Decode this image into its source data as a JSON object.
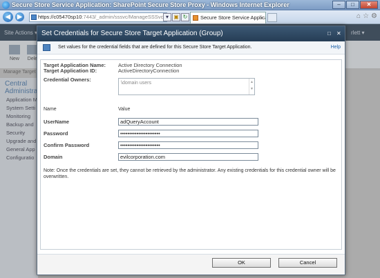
{
  "window": {
    "title": "Secure Store Service Application: SharePoint Secure Store Proxy - Windows Internet Explorer",
    "minimize": "–",
    "maximize": "□",
    "close": "✕"
  },
  "browser": {
    "url_main": "https://c05470sp10",
    "url_rest": ":7443/_admin/sssvc/ManageSSSvcAppl",
    "tab_title": "Secure Store Service Applica...",
    "tab_close": "x",
    "back": "◀",
    "forward": "▶"
  },
  "sharepoint": {
    "site_actions": "Site Actions ▾",
    "user": "rlett ▾",
    "ribbon_new": "New",
    "ribbon_delete": "Dele",
    "manage_target": "Manage Target",
    "leftnav_head": "Central Administra",
    "leftnav_items": [
      "Application M",
      "System Setti",
      "Monitoring",
      "Backup and",
      "Security",
      "Upgrade and",
      "General App Settings",
      "Configuratio"
    ]
  },
  "dialog": {
    "title": "Set Credentials for Secure Store Target Application (Group)",
    "info_text": "Set values for the credential fields that are defined for this Secure Store Target Application.",
    "help": "Help",
    "target_name_label": "Target Application Name:",
    "target_name_value": "Active Directory Connection",
    "target_id_label": "Target Application ID:",
    "target_id_value": "ActiveDirectoryConnection",
    "owners_label": "Credential Owners:",
    "owners_value": "\\domain users",
    "col_name": "Name",
    "col_value": "Value",
    "fields": [
      {
        "label": "UserName",
        "value": "adQueryAccount"
      },
      {
        "label": "Password",
        "value": "••••••••••••••••••••••"
      },
      {
        "label": "Confirm Password",
        "value": "••••••••••••••••••••••"
      },
      {
        "label": "Domain",
        "value": "evilcorporation.com"
      }
    ],
    "note": "Note: Once the credentials are set, they cannot be retrieved by the administrator. Any existing credentials for this credential owner will be overwritten.",
    "ok": "OK",
    "cancel": "Cancel"
  }
}
